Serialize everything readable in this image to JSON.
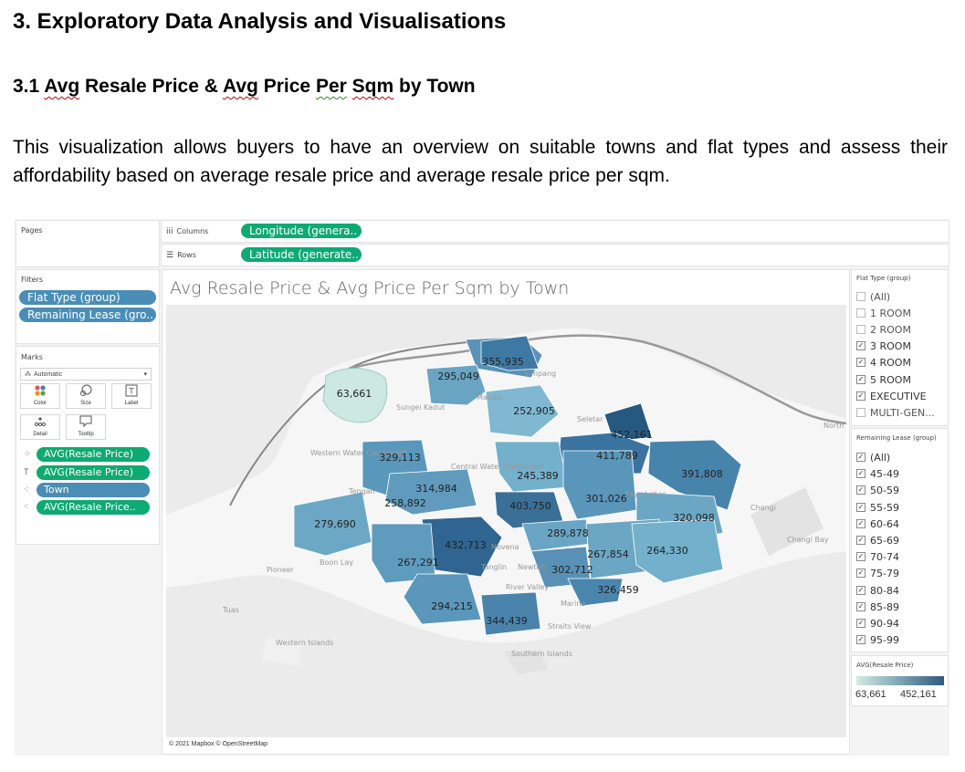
{
  "doc": {
    "heading1": "3.  Exploratory Data Analysis and Visualisations",
    "heading2_parts": [
      "3.1 ",
      "Avg",
      " Resale Price & ",
      "Avg",
      " Price ",
      "Per",
      " ",
      "Sqm",
      " by Town"
    ],
    "paragraph": "This visualization allows buyers to have an overview on suitable towns and flat types and assess their affordability based on average resale price and average resale price per sqm."
  },
  "tableau": {
    "pages_label": "Pages",
    "columns_label": "Columns",
    "columns_pill": "Longitude (genera..",
    "rows_label": "Rows",
    "rows_pill": "Latitude (generate..",
    "filters_label": "Filters",
    "filters": [
      "Flat Type (group)",
      "Remaining Lease (gro.."
    ],
    "marks_label": "Marks",
    "marks_type": "Automatic",
    "marks_buttons": [
      {
        "label": "Color",
        "icon": "color-icon"
      },
      {
        "label": "Size",
        "icon": "size-icon"
      },
      {
        "label": "Label",
        "icon": "label-icon"
      },
      {
        "label": "Detail",
        "icon": "detail-icon"
      },
      {
        "label": "Tooltip",
        "icon": "tooltip-icon"
      }
    ],
    "marks_pills": [
      {
        "label": "AVG(Resale Price)",
        "color": "#0eaa74",
        "icon": "color-icon"
      },
      {
        "label": "AVG(Resale Price)",
        "color": "#0eaa74",
        "icon": "label-icon"
      },
      {
        "label": "Town",
        "color": "#4a8eb7",
        "icon": "detail-icon"
      },
      {
        "label": "AVG(Resale Price..",
        "color": "#0eaa74",
        "icon": "tooltip-icon"
      }
    ],
    "view_title": "Avg Resale Price & Avg Price Per Sqm by Town",
    "map_credit": "© 2021 Mapbox © OpenStreetMap",
    "flat_type_title": "Flat Type (group)",
    "flat_types": [
      {
        "label": "(All)",
        "checked": false
      },
      {
        "label": "1 ROOM",
        "checked": false
      },
      {
        "label": "2 ROOM",
        "checked": false
      },
      {
        "label": "3 ROOM",
        "checked": true
      },
      {
        "label": "4 ROOM",
        "checked": true
      },
      {
        "label": "5 ROOM",
        "checked": true
      },
      {
        "label": "EXECUTIVE",
        "checked": true
      },
      {
        "label": "MULTI-GEN...",
        "checked": false
      }
    ],
    "lease_title": "Remaining Lease (group)",
    "lease_groups": [
      {
        "label": "(All)",
        "checked": true
      },
      {
        "label": "45-49",
        "checked": true
      },
      {
        "label": "50-59",
        "checked": true
      },
      {
        "label": "55-59",
        "checked": true
      },
      {
        "label": "60-64",
        "checked": true
      },
      {
        "label": "65-69",
        "checked": true
      },
      {
        "label": "70-74",
        "checked": true
      },
      {
        "label": "75-79",
        "checked": true
      },
      {
        "label": "80-84",
        "checked": true
      },
      {
        "label": "85-89",
        "checked": true
      },
      {
        "label": "90-94",
        "checked": true
      },
      {
        "label": "95-99",
        "checked": true
      }
    ],
    "color_legend_title": "AVG(Resale Price)",
    "color_min": "63,661",
    "color_max": "452,161",
    "color_low": "#d2ece4",
    "color_high": "#2c5a80"
  },
  "map": {
    "place_labels": [
      "Simpang",
      "Mandai",
      "Sungei Kadut",
      "Seletar",
      "Western Water Catchment",
      "Central Water Catchment",
      "Tengah",
      "Paya Lebar",
      "Changi",
      "Changi Bay",
      "North Is",
      "Novena",
      "Tanglin",
      "Newton",
      "River Valley",
      "Marina",
      "Straits View",
      "Pioneer",
      "Boon Lay",
      "Tuas",
      "Western Islands",
      "Southern Islands"
    ],
    "value_labels": [
      "355,935",
      "295,049",
      "63,661",
      "252,905",
      "452,161",
      "411,789",
      "391,808",
      "329,113",
      "245,389",
      "314,984",
      "258,892",
      "403,750",
      "301,026",
      "320,098",
      "279,690",
      "289,878",
      "432,713",
      "267,854",
      "264,330",
      "267,291",
      "302,712",
      "326,459",
      "294,215",
      "344,439"
    ]
  }
}
